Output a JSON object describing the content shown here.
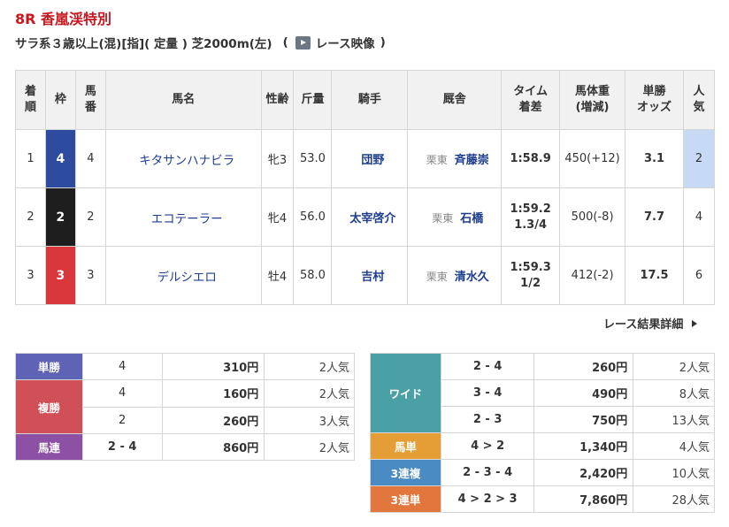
{
  "race": {
    "title": "8R 香嵐渓特別",
    "conditions": "サラ系３歳以上(混)[指]( 定量 ) 芝2000m(左)",
    "paren_open": "(",
    "video_label": "レース映像",
    "paren_close": ")"
  },
  "table": {
    "headers": [
      "着\n順",
      "枠",
      "馬\n番",
      "馬名",
      "性齢",
      "斤量",
      "騎手",
      "厩舎",
      "タイム\n着差",
      "馬体重\n(増減)",
      "単勝\nオッズ",
      "人\n気"
    ],
    "rows": [
      {
        "rank": "1",
        "waku": "4",
        "umaban": "4",
        "name": "キタサンハナビラ",
        "sexage": "牝3",
        "weight": "53.0",
        "jockey": "団野",
        "area": "栗東",
        "trainer": "斉藤崇",
        "time": "1:58.9",
        "margin": "",
        "body": "450(+12)",
        "odds": "3.1",
        "pop": "2"
      },
      {
        "rank": "2",
        "waku": "2",
        "umaban": "2",
        "name": "エコテーラー",
        "sexage": "牝4",
        "weight": "56.0",
        "jockey": "太宰啓介",
        "area": "栗東",
        "trainer": "石橋",
        "time": "1:59.2",
        "margin": "1.3/4",
        "body": "500(-8)",
        "odds": "7.7",
        "pop": "4"
      },
      {
        "rank": "3",
        "waku": "3",
        "umaban": "3",
        "name": "デルシエロ",
        "sexage": "牡4",
        "weight": "58.0",
        "jockey": "吉村",
        "area": "栗東",
        "trainer": "清水久",
        "time": "1:59.3",
        "margin": "1/2",
        "body": "412(-2)",
        "odds": "17.5",
        "pop": "6"
      }
    ]
  },
  "detail_link": "レース結果詳細",
  "payouts_left": {
    "tansho": {
      "label": "単勝",
      "combo": "4",
      "amount": "310円",
      "pop": "2人気"
    },
    "fukusho": {
      "label": "複勝",
      "rows": [
        {
          "combo": "4",
          "amount": "160円",
          "pop": "2人気"
        },
        {
          "combo": "2",
          "amount": "260円",
          "pop": "3人気"
        }
      ]
    },
    "umaren": {
      "label": "馬連",
      "combo": "2 - 4",
      "amount": "860円",
      "pop": "2人気"
    }
  },
  "payouts_right": {
    "wide": {
      "label": "ワイド",
      "rows": [
        {
          "combo": "2 - 4",
          "amount": "260円",
          "pop": "2人気"
        },
        {
          "combo": "3 - 4",
          "amount": "490円",
          "pop": "8人気"
        },
        {
          "combo": "2 - 3",
          "amount": "750円",
          "pop": "13人気"
        }
      ]
    },
    "umatan": {
      "label": "馬単",
      "combo": "4 > 2",
      "amount": "1,340円",
      "pop": "4人気"
    },
    "sanrenpuku": {
      "label": "3連複",
      "combo": "2 - 3 - 4",
      "amount": "2,420円",
      "pop": "10人気"
    },
    "sanrentan": {
      "label": "3連単",
      "combo": "4 > 2 > 3",
      "amount": "7,860円",
      "pop": "28人気"
    }
  },
  "colors": {
    "title_red": "#c9171e",
    "waku_4": "#2d4b9f",
    "waku_2": "#1e1e1e",
    "waku_3": "#d9373b",
    "tansho": "#5f63b6",
    "fukusho": "#d14f56",
    "umaren": "#8c51a4",
    "wide": "#4aa0a4",
    "umatan": "#e59d36",
    "sanrenpuku": "#4b8bc4",
    "sanrentan": "#e2773d"
  },
  "icons": {
    "video": "play-video-icon",
    "detail_arrow": "chevron-right-icon"
  }
}
